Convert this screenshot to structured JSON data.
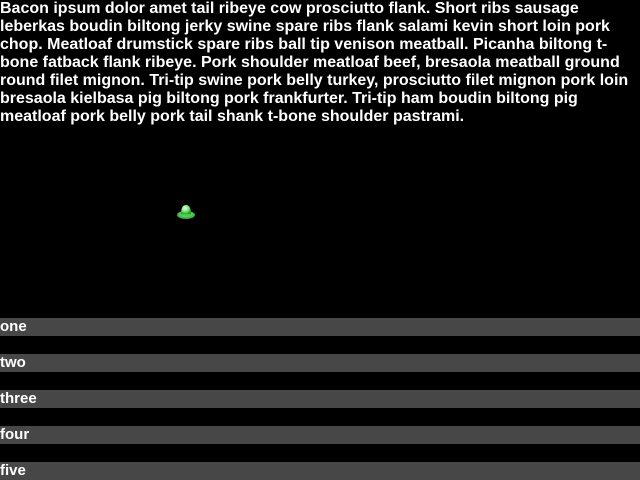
{
  "paragraph": {
    "text": "Bacon ipsum dolor amet tail ribeye cow prosciutto flank. Short ribs sausage leberkas boudin biltong jerky swine spare ribs flank salami kevin short loin pork chop. Meatloaf drumstick spare ribs ball tip venison meatball. Picanha biltong t-bone fatback flank ribeye. Pork shoulder meatloaf beef, bresaola meatball ground round filet mignon. Tri-tip swine pork belly turkey, prosciutto filet mignon pork loin bresaola kielbasa pig biltong pork frankfurter. Tri-tip ham boudin biltong pig meatloaf pork belly pork tail shank t-bone shoulder pastrami."
  },
  "sprite": {
    "icon": "ufo-icon",
    "color": "#22c422"
  },
  "options": [
    {
      "label": "one"
    },
    {
      "label": "two"
    },
    {
      "label": "three"
    },
    {
      "label": "four"
    },
    {
      "label": "five"
    }
  ],
  "colors": {
    "background": "#000000",
    "text": "#ffffff",
    "option_bar": "#474747"
  }
}
